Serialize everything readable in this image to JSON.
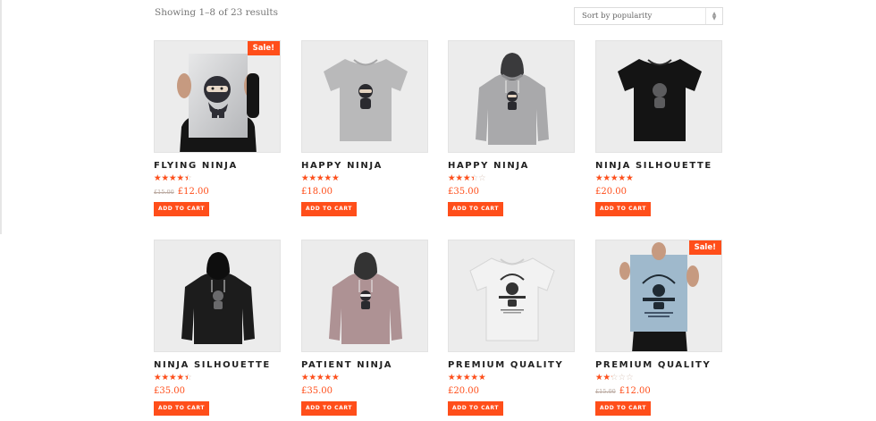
{
  "shop": {
    "result_count": "Showing 1–8 of 23 results",
    "sort": {
      "selected": "Sort by popularity"
    }
  },
  "colors": {
    "accent": "#ff4e1a",
    "thumb_bg": "#ececec"
  },
  "products": [
    {
      "title": "FLYING NINJA",
      "rating": 4,
      "old_price": "£15.00",
      "price": "£12.00",
      "sale": "Sale!",
      "button": "ADD TO CART",
      "image": "poster-ninja"
    },
    {
      "title": "HAPPY NINJA",
      "rating": 5,
      "old_price": "",
      "price": "£18.00",
      "sale": "",
      "button": "ADD TO CART",
      "image": "grey-tshirt"
    },
    {
      "title": "HAPPY NINJA",
      "rating": 3,
      "old_price": "",
      "price": "£35.00",
      "sale": "",
      "button": "ADD TO CART",
      "image": "grey-hoodie"
    },
    {
      "title": "NINJA SILHOUETTE",
      "rating": 5,
      "old_price": "",
      "price": "£20.00",
      "sale": "",
      "button": "ADD TO CART",
      "image": "black-tshirt"
    },
    {
      "title": "NINJA SILHOUETTE",
      "rating": 4,
      "old_price": "",
      "price": "£35.00",
      "sale": "",
      "button": "ADD TO CART",
      "image": "black-hoodie"
    },
    {
      "title": "PATIENT NINJA",
      "rating": 5,
      "old_price": "",
      "price": "£35.00",
      "sale": "",
      "button": "ADD TO CART",
      "image": "pink-hoodie"
    },
    {
      "title": "PREMIUM QUALITY",
      "rating": 4.5,
      "old_price": "",
      "price": "£20.00",
      "sale": "",
      "button": "ADD TO CART",
      "image": "white-tshirt"
    },
    {
      "title": "PREMIUM QUALITY",
      "rating": 2,
      "old_price": "£15.00",
      "price": "£12.00",
      "sale": "Sale!",
      "button": "ADD TO CART",
      "image": "poster-premium"
    }
  ]
}
